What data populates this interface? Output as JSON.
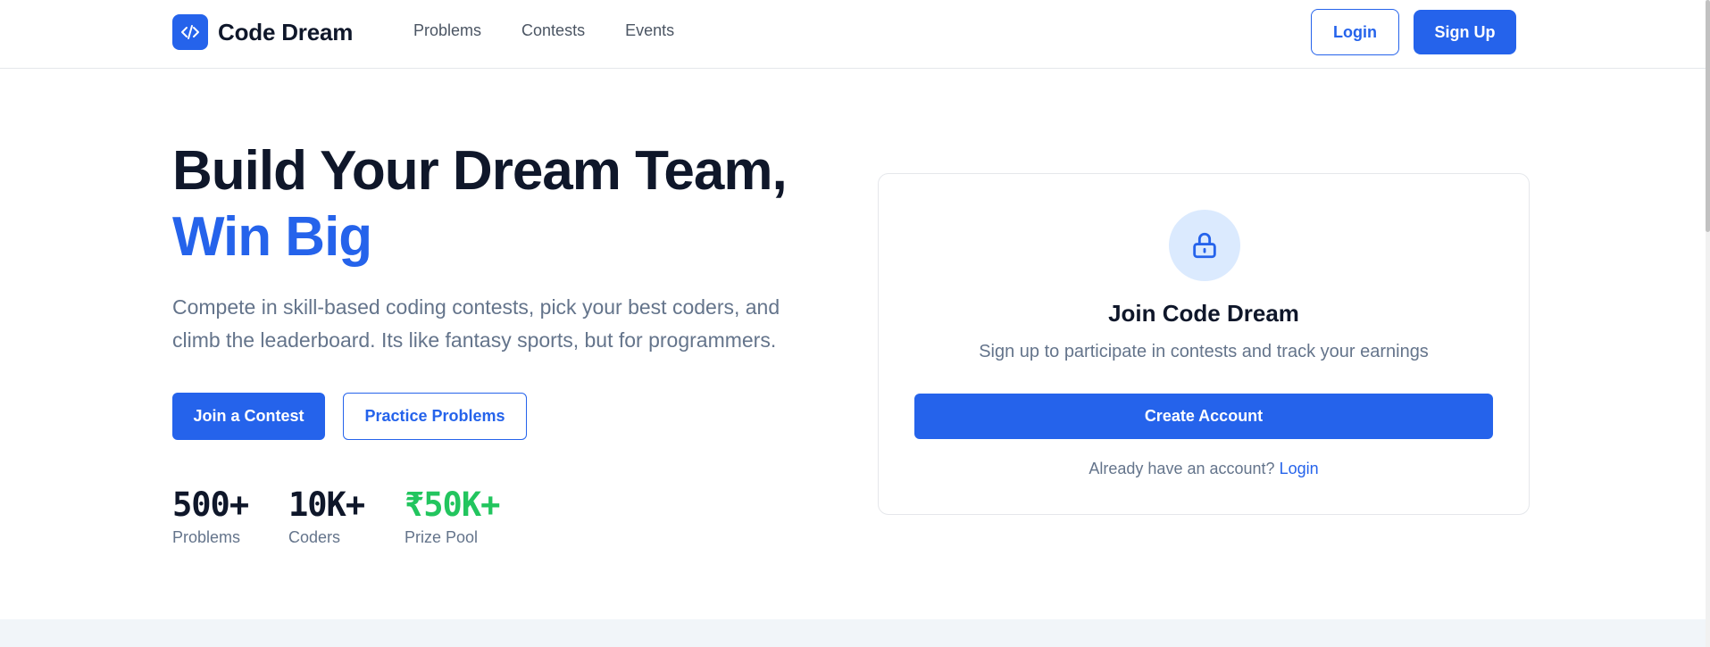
{
  "nav": {
    "brand": "Code Dream",
    "links": [
      "Problems",
      "Contests",
      "Events"
    ],
    "login": "Login",
    "signup": "Sign Up"
  },
  "hero": {
    "title_line1": "Build Your Dream Team,",
    "title_line2": "Win Big",
    "description": "Compete in skill-based coding contests, pick your best coders, and climb the leaderboard. Its like fantasy sports, but for programmers.",
    "primary_button": "Join a Contest",
    "secondary_button": "Practice Problems",
    "stats": [
      {
        "value": "500+",
        "label": "Problems"
      },
      {
        "value": "10K+",
        "label": "Coders"
      },
      {
        "value": "₹50K+",
        "label": "Prize Pool"
      }
    ]
  },
  "card": {
    "title": "Join Code Dream",
    "subtitle": "Sign up to participate in contests and track your earnings",
    "button": "Create Account",
    "footer_text": "Already have an account?",
    "footer_link": "Login"
  },
  "colors": {
    "brand": "#2563eb",
    "prize": "#22c55e",
    "text": "#0f172a",
    "muted": "#64748b"
  },
  "icons": {
    "logo": "code-icon",
    "card": "lock-icon"
  }
}
